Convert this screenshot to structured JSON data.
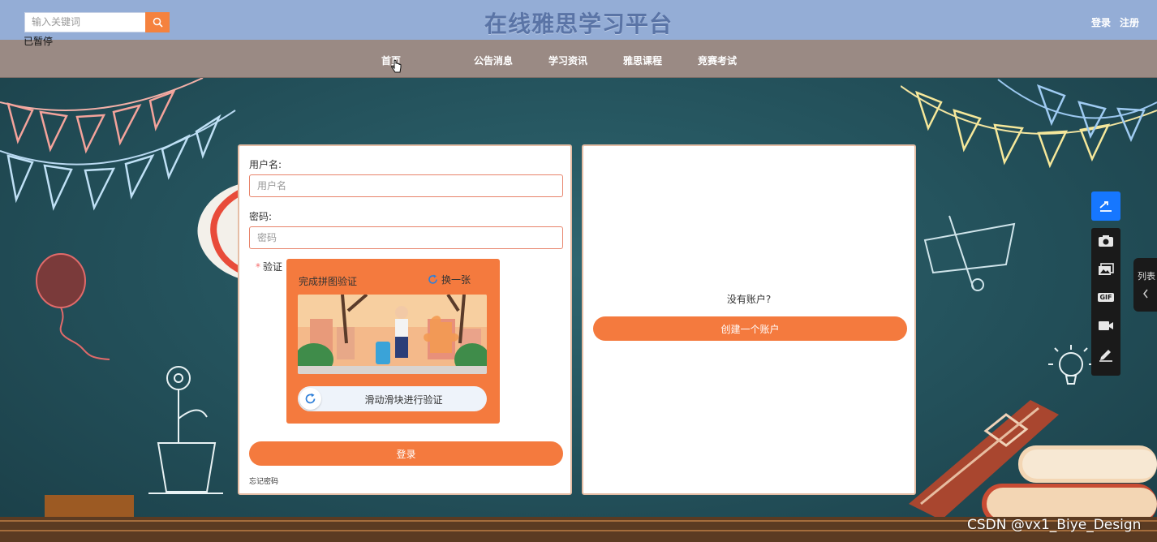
{
  "header": {
    "search_placeholder": "输入关键词",
    "paused_label": "已暂停",
    "site_title": "在线雅思学习平台",
    "login_link": "登录",
    "register_link": "注册"
  },
  "nav": {
    "items": [
      {
        "label": "首页"
      },
      {
        "label": "公告消息"
      },
      {
        "label": "学习资讯"
      },
      {
        "label": "雅思课程"
      },
      {
        "label": "竞赛考试"
      }
    ]
  },
  "login_form": {
    "username_label": "用户名:",
    "username_placeholder": "用户名",
    "password_label": "密码:",
    "password_placeholder": "密码",
    "captcha_label": "验证",
    "captcha_title": "完成拼图验证",
    "captcha_refresh": "换一张",
    "slider_text": "滑动滑块进行验证",
    "login_button": "登录",
    "forgot_password": "忘记密码"
  },
  "register_panel": {
    "no_account_text": "没有账户?",
    "create_button": "创建一个账户"
  },
  "side_toolbar": {
    "list_tab_label": "列表",
    "gif_label": "GIF"
  },
  "watermark": "CSDN @vx1_Biye_Design",
  "colors": {
    "header_bg": "#94add6",
    "nav_bg": "#9a8a84",
    "accent": "#f47a3e",
    "toolbar_accent": "#1677ff"
  }
}
